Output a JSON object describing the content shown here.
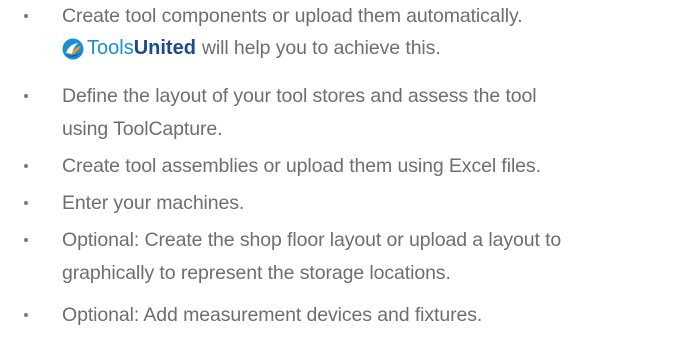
{
  "items": [
    {
      "lines": [
        "Create tool components or upload them automatically."
      ],
      "logo_line": {
        "logo_icon": "toolsunited-logo-icon",
        "logo_text_1": "Tools",
        "logo_text_2": "United",
        "after_text": "will help you to achieve this."
      }
    },
    {
      "lines": [
        "Define the layout of your tool stores and assess the tool",
        "using ToolCapture."
      ]
    },
    {
      "lines": [
        "Create tool assemblies or upload them using Excel files."
      ]
    },
    {
      "lines": [
        "Enter your machines."
      ]
    },
    {
      "lines": [
        "Optional: Create the shop floor layout or upload a layout to",
        "graphically to represent the storage locations."
      ]
    },
    {
      "lines": [
        "Optional: Add measurement devices and fixtures."
      ]
    }
  ],
  "colors": {
    "text": "#6d6e71",
    "logo_tools": "#1b8ed6",
    "logo_united": "#1a4b8c",
    "logo_orange": "#f39a1e"
  }
}
